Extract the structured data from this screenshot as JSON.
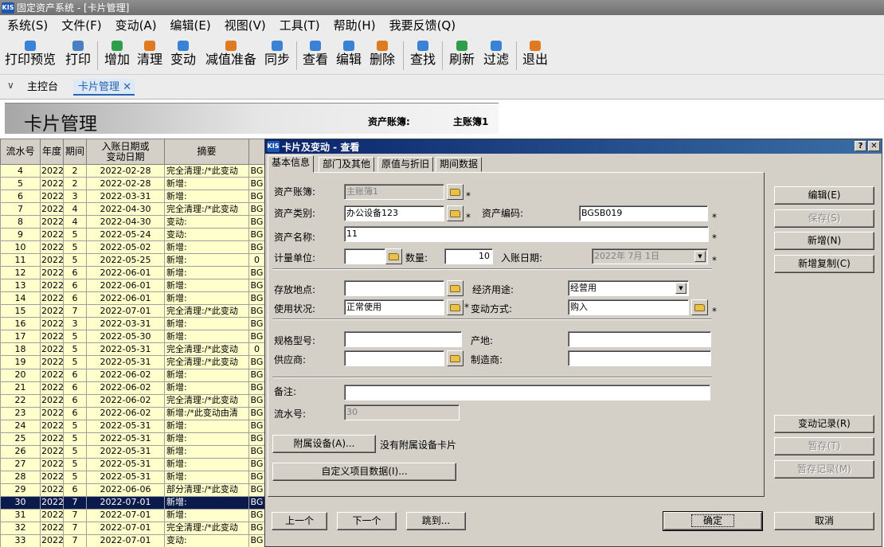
{
  "window": {
    "title": "固定资产系统 - [卡片管理]",
    "app_logo": "KIS"
  },
  "menu": [
    "系统(S)",
    "文件(F)",
    "变动(A)",
    "编辑(E)",
    "视图(V)",
    "工具(T)",
    "帮助(H)",
    "我要反馈(Q)"
  ],
  "toolbar": [
    {
      "label": "打印预览",
      "icon": "print-preview-icon",
      "color": "#3a82d6"
    },
    {
      "label": "打印",
      "icon": "printer-icon",
      "color": "#4a7fc0"
    },
    {
      "label": "增加",
      "icon": "add-icon",
      "color": "#2f9e4a"
    },
    {
      "label": "清理",
      "icon": "clear-icon",
      "color": "#e07a20"
    },
    {
      "label": "变动",
      "icon": "change-icon",
      "color": "#3a82d6"
    },
    {
      "label": "减值准备",
      "icon": "impairment-icon",
      "color": "#e07a20"
    },
    {
      "label": "同步",
      "icon": "sync-icon",
      "color": "#3a82d6"
    },
    {
      "label": "查看",
      "icon": "view-icon",
      "color": "#3a82d6"
    },
    {
      "label": "编辑",
      "icon": "edit-icon",
      "color": "#3a82d6"
    },
    {
      "label": "删除",
      "icon": "delete-icon",
      "color": "#e07a20"
    },
    {
      "label": "查找",
      "icon": "find-icon",
      "color": "#3a82d6"
    },
    {
      "label": "刷新",
      "icon": "refresh-icon",
      "color": "#2f9e4a"
    },
    {
      "label": "过滤",
      "icon": "filter-icon",
      "color": "#3a82d6"
    },
    {
      "label": "退出",
      "icon": "exit-icon",
      "color": "#e07a20"
    }
  ],
  "tabs": {
    "home": "主控台",
    "active": "卡片管理",
    "close": "✕"
  },
  "banner": {
    "title": "卡片管理",
    "book_label": "资产账簿:",
    "book_value": "主账簿1"
  },
  "grid": {
    "headers": [
      "流水号",
      "年度",
      "期间",
      "入账日期或\n变动日期",
      "摘要",
      ""
    ],
    "rows": [
      [
        "4",
        "2022",
        "2",
        "2022-02-28",
        "完全清理:/*此变动",
        "BG"
      ],
      [
        "5",
        "2022",
        "2",
        "2022-02-28",
        "新增:",
        "BG"
      ],
      [
        "6",
        "2022",
        "3",
        "2022-03-31",
        "新增:",
        "BG"
      ],
      [
        "7",
        "2022",
        "4",
        "2022-04-30",
        "完全清理:/*此变动",
        "BG"
      ],
      [
        "8",
        "2022",
        "4",
        "2022-04-30",
        "变动:",
        "BG"
      ],
      [
        "9",
        "2022",
        "5",
        "2022-05-24",
        "变动:",
        "BG"
      ],
      [
        "10",
        "2022",
        "5",
        "2022-05-02",
        "新增:",
        "BG"
      ],
      [
        "11",
        "2022",
        "5",
        "2022-05-25",
        "新增:",
        "0"
      ],
      [
        "12",
        "2022",
        "6",
        "2022-06-01",
        "新增:",
        "BG"
      ],
      [
        "13",
        "2022",
        "6",
        "2022-06-01",
        "新增:",
        "BG"
      ],
      [
        "14",
        "2022",
        "6",
        "2022-06-01",
        "新增:",
        "BG"
      ],
      [
        "15",
        "2022",
        "7",
        "2022-07-01",
        "完全清理:/*此变动",
        "BG"
      ],
      [
        "16",
        "2022",
        "3",
        "2022-03-31",
        "新增:",
        "BG"
      ],
      [
        "17",
        "2022",
        "5",
        "2022-05-30",
        "新增:",
        "BG"
      ],
      [
        "18",
        "2022",
        "5",
        "2022-05-31",
        "完全清理:/*此变动",
        "0"
      ],
      [
        "19",
        "2022",
        "5",
        "2022-05-31",
        "完全清理:/*此变动",
        "BG"
      ],
      [
        "20",
        "2022",
        "6",
        "2022-06-02",
        "新增:",
        "BG"
      ],
      [
        "21",
        "2022",
        "6",
        "2022-06-02",
        "新增:",
        "BG"
      ],
      [
        "22",
        "2022",
        "6",
        "2022-06-02",
        "完全清理:/*此变动",
        "BG"
      ],
      [
        "23",
        "2022",
        "6",
        "2022-06-02",
        "新增:/*此变动由清",
        "BG"
      ],
      [
        "24",
        "2022",
        "5",
        "2022-05-31",
        "新增:",
        "BG"
      ],
      [
        "25",
        "2022",
        "5",
        "2022-05-31",
        "新增:",
        "BG"
      ],
      [
        "26",
        "2022",
        "5",
        "2022-05-31",
        "新增:",
        "BG"
      ],
      [
        "27",
        "2022",
        "5",
        "2022-05-31",
        "新增:",
        "BG"
      ],
      [
        "28",
        "2022",
        "5",
        "2022-05-31",
        "新增:",
        "BG"
      ],
      [
        "29",
        "2022",
        "6",
        "2022-06-06",
        "部分清理:/*此变动",
        "BG"
      ],
      [
        "30",
        "2022",
        "7",
        "2022-07-01",
        "新增:",
        "BG"
      ],
      [
        "31",
        "2022",
        "7",
        "2022-07-01",
        "新增:",
        "BG"
      ],
      [
        "32",
        "2022",
        "7",
        "2022-07-01",
        "完全清理:/*此变动",
        "BG"
      ],
      [
        "33",
        "2022",
        "7",
        "2022-07-01",
        "变动:",
        "BG"
      ]
    ],
    "selected_index": 26
  },
  "dialog": {
    "title": "卡片及变动 - 查看",
    "help": "?",
    "close": "✕",
    "tabs": [
      "基本信息",
      "部门及其他",
      "原值与折旧",
      "期间数据"
    ],
    "labels": {
      "book": "资产账簿:",
      "category": "资产类别:",
      "code": "资产编码:",
      "name": "资产名称:",
      "unit": "计量单位:",
      "qty": "数量:",
      "date": "入账日期:",
      "location": "存放地点:",
      "usage": "经济用途:",
      "status": "使用状况:",
      "change_method": "变动方式:",
      "spec": "规格型号:",
      "origin": "产地:",
      "supplier": "供应商:",
      "maker": "制造商:",
      "remark": "备注:",
      "serial": "流水号:",
      "no_attach": "没有附属设备卡片"
    },
    "values": {
      "book": "主账簿1",
      "category": "办公设备123",
      "code": "BGSB019",
      "name": "11",
      "unit": "",
      "qty": "10",
      "date": "2022年 7月 1日",
      "location": "",
      "usage": "经营用",
      "status": "正常使用",
      "change_method": "购入",
      "spec": "",
      "origin": "",
      "supplier": "",
      "maker": "",
      "remark": "",
      "serial": "30"
    },
    "required_mark": "*",
    "buttons": {
      "attach": "附属设备(A)...",
      "custom": "自定义项目数据(I)...",
      "edit": "编辑(E)",
      "save": "保存(S)",
      "add": "新增(N)",
      "add_copy": "新增复制(C)",
      "change_record": "变动记录(R)",
      "hold": "暂存(T)",
      "hold_record": "暂存记录(M)",
      "prev": "上一个",
      "next": "下一个",
      "jump": "跳到...",
      "ok": "确定",
      "cancel": "取消"
    }
  }
}
